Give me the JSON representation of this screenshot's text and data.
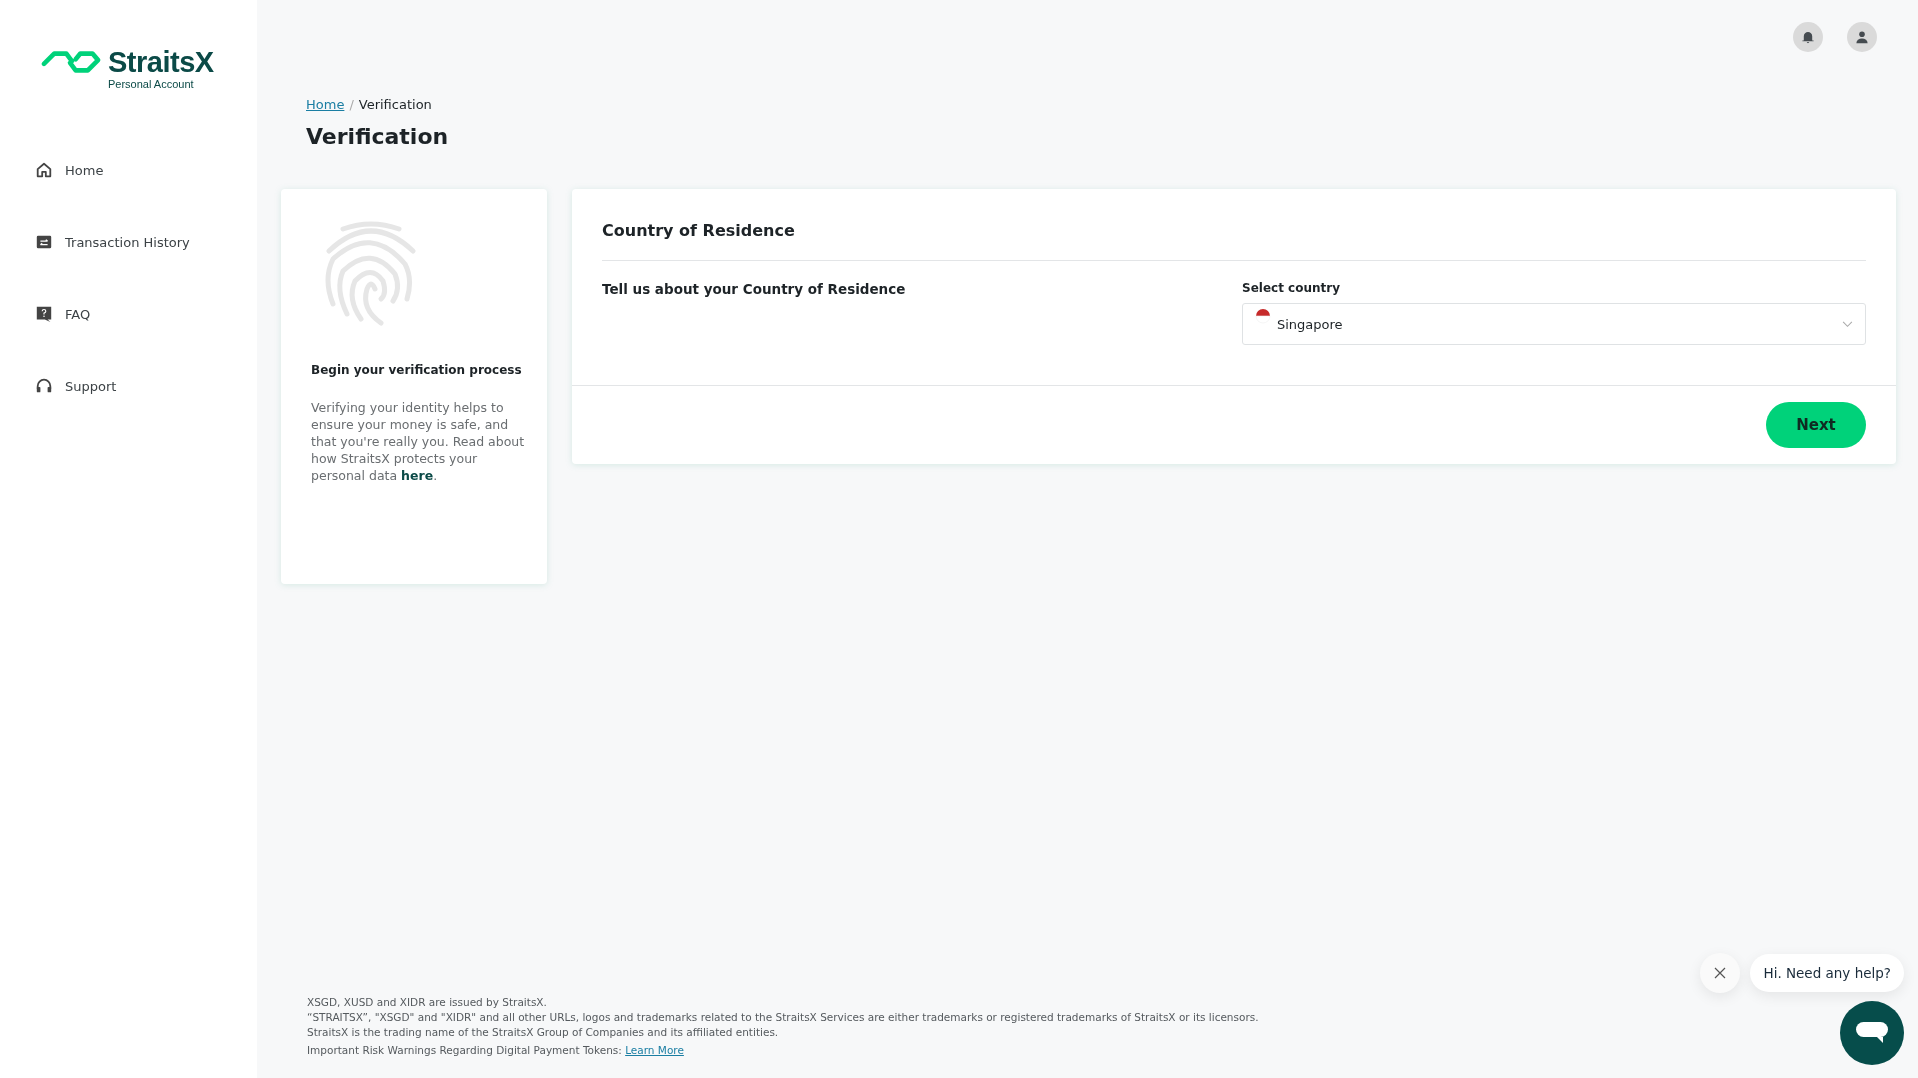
{
  "logo": {
    "name": "StraitsX",
    "subtitle": "Personal Account"
  },
  "sidebar": {
    "items": [
      {
        "label": "Home",
        "kind": "home",
        "selected": false
      },
      {
        "label": "Transaction History",
        "kind": "history",
        "selected": false
      },
      {
        "label": "FAQ",
        "kind": "faq",
        "selected": false
      },
      {
        "label": "Support",
        "kind": "support",
        "selected": false
      }
    ]
  },
  "breadcrumb": {
    "link": "Home",
    "separator": "/",
    "current": "Verification"
  },
  "page_title": "Verification",
  "intro_card": {
    "title": "Begin your verification process",
    "text": "Verifying your identity helps to ensure your money is safe, and that you're really you. Read about how StraitsX protects your personal data",
    "link": "here",
    "suffix": "."
  },
  "form_card": {
    "title": "Country of Residence",
    "prompt": "Tell us about your Country of Residence",
    "field_label": "Select country",
    "value": "Singapore",
    "button": "Next"
  },
  "footer": {
    "lines": [
      "XSGD, XUSD and XIDR are issued by StraitsX.",
      "“STRAITSX”, \"XSGD\" and \"XIDR\" and all other URLs, logos and trademarks related to the StraitsX Services are either trademarks or registered trademarks of StraitsX or its licensors.",
      "StraitsX is the trading name of the StraitsX Group of Companies and its affiliated entities."
    ],
    "warning": "Important Risk Warnings Regarding Digital Payment Tokens:",
    "warning_link": "Learn More"
  },
  "chat": {
    "message": "Hi. Need any help?"
  }
}
